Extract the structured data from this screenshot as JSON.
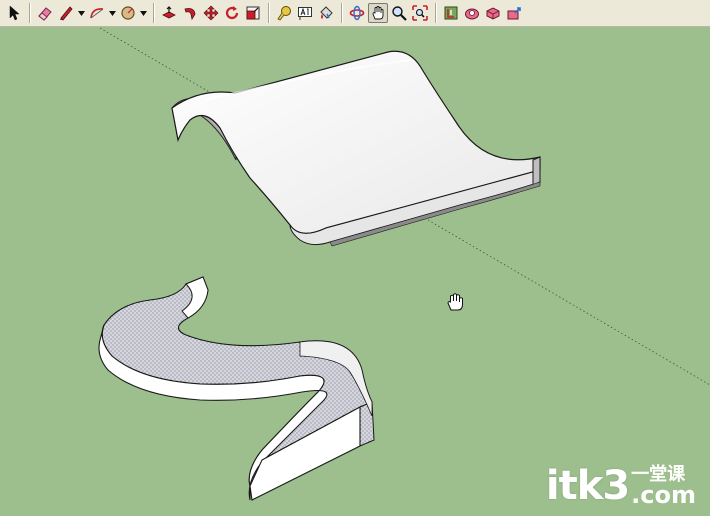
{
  "toolbar": {
    "tools": [
      {
        "name": "select-tool",
        "icon": "arrow-cursor-icon"
      },
      {
        "name": "eraser-tool",
        "icon": "eraser-icon"
      },
      {
        "name": "pencil-line-tool",
        "icon": "pencil-icon",
        "dropdown": true
      },
      {
        "name": "arc-tool",
        "icon": "arc-icon",
        "dropdown": true
      },
      {
        "name": "circle-tool",
        "icon": "circle-icon",
        "dropdown": true
      },
      {
        "name": "push-pull-tool",
        "icon": "push-pull-icon"
      },
      {
        "name": "follow-me-tool",
        "icon": "follow-me-icon"
      },
      {
        "name": "move-tool",
        "icon": "move-icon"
      },
      {
        "name": "rotate-tool",
        "icon": "rotate-icon"
      },
      {
        "name": "scale-tool",
        "icon": "scale-icon"
      },
      {
        "name": "tape-measure-tool",
        "icon": "tape-measure-icon"
      },
      {
        "name": "text-tool",
        "icon": "text-icon"
      },
      {
        "name": "paint-bucket-tool",
        "icon": "paint-bucket-icon"
      },
      {
        "name": "orbit-tool",
        "icon": "orbit-icon"
      },
      {
        "name": "pan-tool",
        "icon": "pan-hand-icon",
        "active": true
      },
      {
        "name": "zoom-tool",
        "icon": "zoom-icon"
      },
      {
        "name": "zoom-extents-tool",
        "icon": "zoom-extents-icon"
      },
      {
        "name": "get-models-tool",
        "icon": "warehouse-icon"
      },
      {
        "name": "share-model-tool",
        "icon": "share-model-icon"
      },
      {
        "name": "components-tool",
        "icon": "components-icon"
      },
      {
        "name": "upload-tool",
        "icon": "upload-icon"
      }
    ]
  },
  "viewport": {
    "background_color": "#9dbf8e",
    "surface_color": "#f4f4f4",
    "shade_color": "#d4d4dc",
    "side_color": "#ffffff",
    "edge_color": "#222222",
    "cursor": "pan-hand-icon"
  },
  "watermark": {
    "main": "itk3",
    "cn": "一堂课",
    "com": ".com"
  }
}
